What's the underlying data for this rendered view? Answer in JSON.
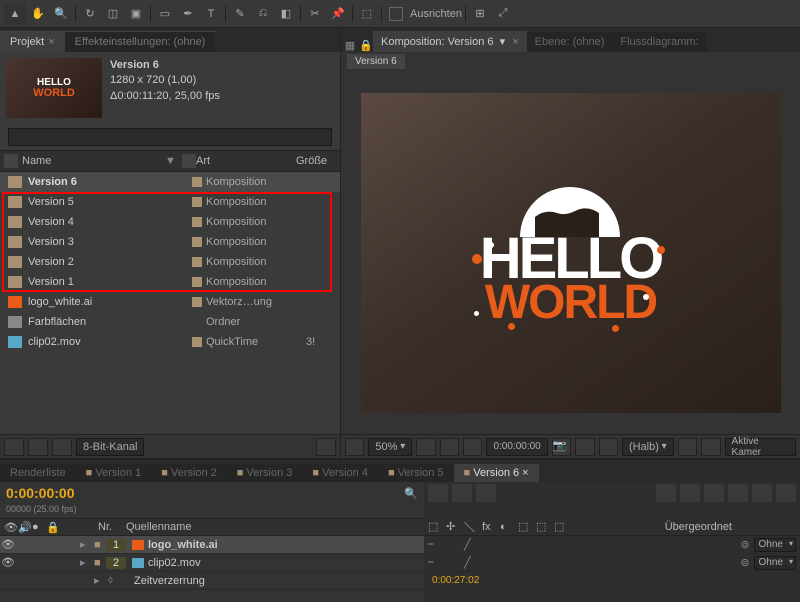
{
  "toolbar": {
    "ausrichten": "Ausrichten"
  },
  "panels": {
    "projekt": "Projekt",
    "effekt": "Effekteinstellungen: (ohne)"
  },
  "thumb": {
    "title": "Version 6",
    "dims": "1280 x 720 (1,00)",
    "dur": "Δ0:00:11:20, 25,00 fps"
  },
  "proj_cols": {
    "name": "Name",
    "art": "Art",
    "size": "Größe"
  },
  "proj_items": [
    {
      "name": "Version 6",
      "art": "Komposition",
      "icon": "comp",
      "sel": true,
      "label": true
    },
    {
      "name": "Version 5",
      "art": "Komposition",
      "icon": "comp",
      "label": true
    },
    {
      "name": "Version 4",
      "art": "Komposition",
      "icon": "comp",
      "label": true
    },
    {
      "name": "Version 3",
      "art": "Komposition",
      "icon": "comp",
      "label": true
    },
    {
      "name": "Version 2",
      "art": "Komposition",
      "icon": "comp",
      "label": true
    },
    {
      "name": "Version 1",
      "art": "Komposition",
      "icon": "comp",
      "label": true
    },
    {
      "name": "logo_white.ai",
      "art": "Vektorz…ung",
      "icon": "ai",
      "label": true
    },
    {
      "name": "Farbflächen",
      "art": "Ordner",
      "icon": "folder",
      "label": false
    },
    {
      "name": "clip02.mov",
      "art": "QuickTime",
      "icon": "mov",
      "size": "3!",
      "label": true
    }
  ],
  "proj_footer": {
    "depth": "8-Bit-Kanal"
  },
  "comp_tabs": {
    "main": "Komposition: Version 6",
    "ebene": "Ebene: (ohne)",
    "fluss": "Flussdiagramm:"
  },
  "breadcrumb": "Version 6",
  "viewer_footer": {
    "zoom": "50%",
    "tc": "0:00:00:00",
    "res": "(Halb)",
    "cam": "Aktive Kamer"
  },
  "tl_tabs": [
    "Renderliste",
    "Version 1",
    "Version 2",
    "Version 3",
    "Version 4",
    "Version 5",
    "Version 6"
  ],
  "tl_tabs_active": 6,
  "tl": {
    "timecode": "0:00:00:00",
    "info": "00000 (25.00 fps)",
    "col_nr": "Nr.",
    "col_src": "Quellenname",
    "col_parent": "Übergeordnet",
    "mode_ohne": "Ohne",
    "zeit": "Zeitverzerrung",
    "sub_tc": "0:00:27:02"
  },
  "layers": [
    {
      "n": "1",
      "name": "logo_white.ai",
      "icon": "ai",
      "sel": true
    },
    {
      "n": "2",
      "name": "clip02.mov",
      "icon": "mov",
      "sel": false
    }
  ]
}
